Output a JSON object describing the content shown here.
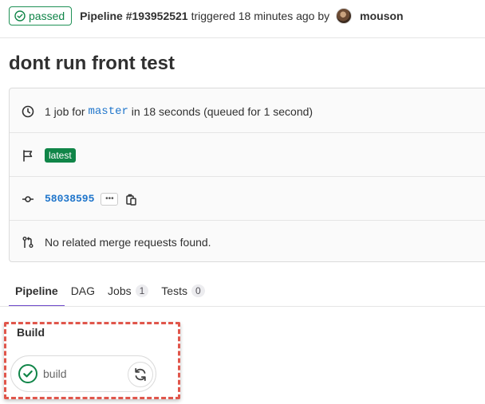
{
  "header": {
    "status_label": "passed",
    "pipeline_label": "Pipeline #193952521",
    "triggered_text": "triggered 18 minutes ago by",
    "author": "mouson"
  },
  "title": "dont run front test",
  "info": {
    "jobs_prefix": "1 job for",
    "branch": "master",
    "jobs_suffix": "in 18 seconds (queued for 1 second)",
    "latest_badge": "latest",
    "commit_sha": "58038595",
    "ellipsis": "•••",
    "merge_requests": "No related merge requests found."
  },
  "tabs": [
    {
      "label": "Pipeline"
    },
    {
      "label": "DAG"
    },
    {
      "label": "Jobs",
      "count": "1"
    },
    {
      "label": "Tests",
      "count": "0"
    }
  ],
  "stage": {
    "title": "Build",
    "job_name": "build",
    "job_status": "success",
    "action_icon": "retry-icon"
  },
  "colors": {
    "success": "#108548",
    "link": "#1f75cb",
    "active_tab": "#6e49cb",
    "highlight": "#e0564b"
  }
}
